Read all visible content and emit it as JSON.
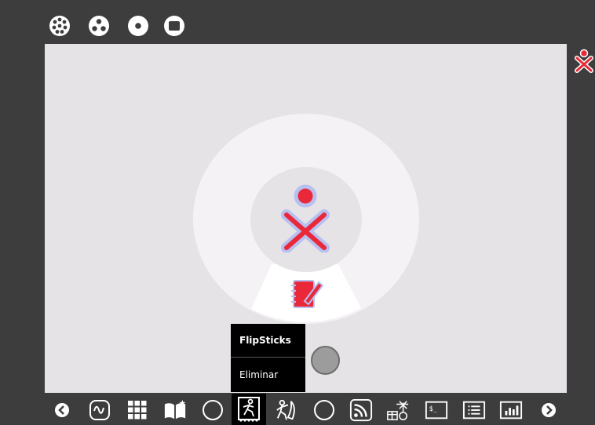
{
  "palette": {
    "title": "FlipSticks",
    "remove_label": "Eliminar"
  },
  "colors": {
    "xo_stroke": "#e9293a",
    "xo_fill": "#b7c0f0",
    "bg": "#3d3d3d",
    "canvas": "#e6e3e6"
  },
  "icons": {
    "topbar": [
      "neighborhood-view-icon",
      "group-view-icon",
      "home-view-icon",
      "activity-view-icon"
    ],
    "dock": [
      "scroll-left-icon",
      "measure-icon",
      "memorize-icon",
      "read-icon",
      "empty-circle-icon",
      "flipsticks-icon",
      "physics-icon",
      "empty-circle-icon",
      "news-reader-icon",
      "tamtam-icon",
      "terminal-icon",
      "list-icon",
      "chart-icon",
      "scroll-right-icon"
    ]
  }
}
